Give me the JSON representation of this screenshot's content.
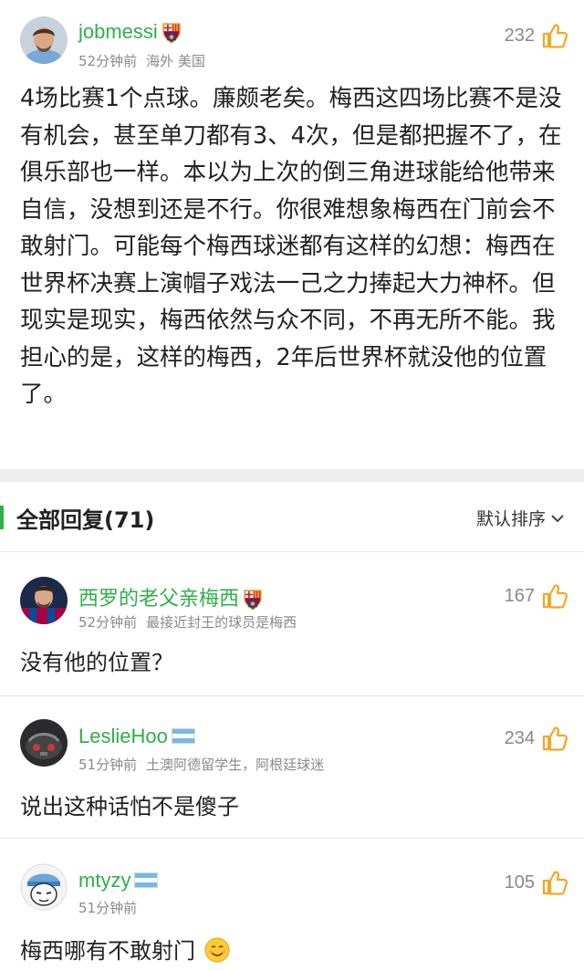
{
  "post": {
    "username": "jobmessi",
    "time": "52分钟前",
    "location": "海外 美国",
    "likes": "232",
    "avatar_icon": "messi-avatar-icon",
    "badge_icon": "fc-barcelona-badge-icon",
    "body": "4场比赛1个点球。廉颇老矣。梅西这四场比赛不是没有机会，甚至单刀都有3、4次，但是都把握不了，在俱乐部也一样。本以为上次的倒三角进球能给他带来自信，没想到还是不行。你很难想象梅西在门前会不敢射门。可能每个梅西球迷都有这样的幻想：梅西在世界杯决赛上演帽子戏法一己之力捧起大力神杯。但现实是现实，梅西依然与众不同，不再无所不能。我担心的是，这样的梅西，2年后世界杯就没他的位置了。"
  },
  "replies_section": {
    "title": "全部回复(71)",
    "sort_label": "默认排序"
  },
  "replies": [
    {
      "username": "西罗的老父亲梅西",
      "time": "52分钟前",
      "bio": "最接近封王的球员是梅西",
      "likes": "167",
      "text": "没有他的位置？",
      "badge": "fc-barcelona-badge-icon"
    },
    {
      "username": "LeslieHoo",
      "time": "51分钟前",
      "bio": "土澳阿德留学生，阿根廷球迷",
      "likes": "234",
      "text": "说出这种话怕不是傻子",
      "badge": "argentina-flag-icon"
    },
    {
      "username": "mtyzy",
      "time": "51分钟前",
      "bio": "",
      "likes": "105",
      "text": "梅西哪有不敢射门",
      "badge": "argentina-flag-icon",
      "text_emoji": "smile-emoji-icon"
    }
  ],
  "colors": {
    "username_green": "#2eb049",
    "like_orange": "#f5a623",
    "meta_gray": "#8a8a8a"
  }
}
